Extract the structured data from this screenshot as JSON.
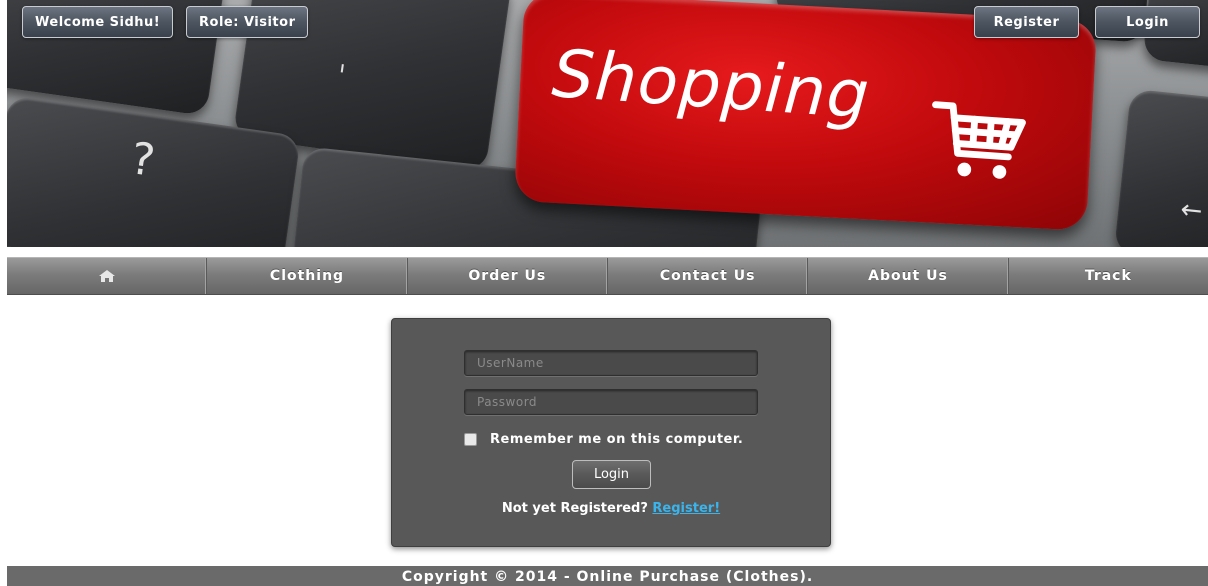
{
  "banner": {
    "brand_text": "Shopping",
    "welcome_label": "Welcome Sidhu!",
    "role_label": "Role: Visitor",
    "register_label": "Register",
    "login_label": "Login",
    "key_accent": "#c20a0d"
  },
  "nav": {
    "home_icon": "home-icon",
    "items": [
      "Clothing",
      "Order Us",
      "Contact Us",
      "About Us",
      "Track"
    ]
  },
  "login_form": {
    "username_placeholder": "UserName",
    "password_placeholder": "Password",
    "remember_label": "Remember me on this computer.",
    "remember_checked": false,
    "submit_label": "Login",
    "not_registered_text": "Not yet Registered?",
    "register_link": "Register!",
    "link_color": "#3ab4ec"
  },
  "footer": {
    "copyright": "Copyright © 2014 - Online Purchase (Clothes)."
  }
}
